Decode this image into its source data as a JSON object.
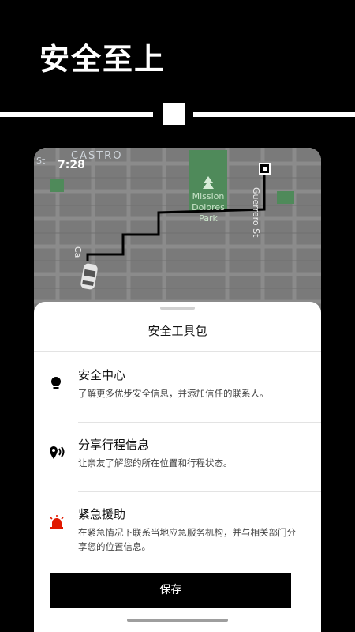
{
  "banner": {
    "headline": "安全至上"
  },
  "status_bar": {
    "time": "7:28"
  },
  "map": {
    "labels": {
      "district": "CASTRO",
      "street_left": "St",
      "park": "Mission Dolores Park",
      "street_right": "Guerrero St",
      "street_bottom": "Ca"
    }
  },
  "sheet": {
    "title": "安全工具包",
    "items": [
      {
        "icon": "lightbulb-icon",
        "title": "安全中心",
        "desc": "了解更多优步安全信息，并添加信任的联系人。"
      },
      {
        "icon": "share-location-icon",
        "title": "分享行程信息",
        "desc": "让亲友了解您的所在位置和行程状态。"
      },
      {
        "icon": "emergency-siren-icon",
        "title": "紧急援助",
        "desc": "在紧急情况下联系当地应急服务机构，并与相关部门分享您的位置信息。"
      }
    ],
    "save_label": "保存"
  },
  "colors": {
    "background": "#000000",
    "siren_red": "#e11900",
    "map_bg": "#7a7a7a",
    "park_green": "#4f8a5a"
  }
}
